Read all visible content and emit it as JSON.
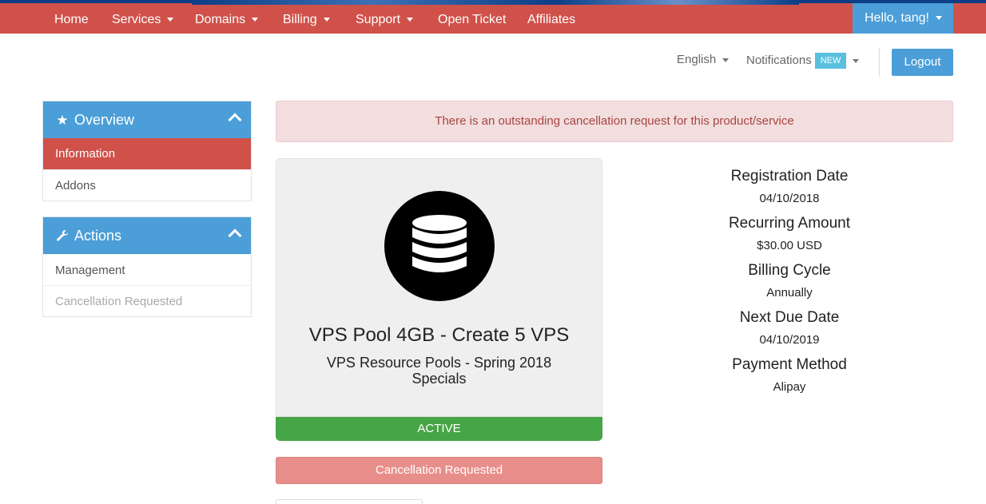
{
  "nav": {
    "items": [
      {
        "label": "Home",
        "dropdown": false
      },
      {
        "label": "Services",
        "dropdown": true
      },
      {
        "label": "Domains",
        "dropdown": true
      },
      {
        "label": "Billing",
        "dropdown": true
      },
      {
        "label": "Support",
        "dropdown": true
      },
      {
        "label": "Open Ticket",
        "dropdown": false
      },
      {
        "label": "Affiliates",
        "dropdown": false
      }
    ],
    "account_label": "Hello, tang!"
  },
  "secondary": {
    "language": "English",
    "notifications": "Notifications",
    "new_badge": "NEW",
    "logout": "Logout"
  },
  "sidebar": {
    "overview": {
      "title": "Overview",
      "icon": "star-icon",
      "items": [
        {
          "label": "Information",
          "state": "active"
        },
        {
          "label": "Addons",
          "state": "normal"
        }
      ]
    },
    "actions": {
      "title": "Actions",
      "icon": "wrench-icon",
      "items": [
        {
          "label": "Management",
          "state": "normal"
        },
        {
          "label": "Cancellation Requested",
          "state": "disabled"
        }
      ]
    }
  },
  "alert": {
    "message": "There is an outstanding cancellation request for this product/service"
  },
  "product": {
    "icon": "database-icon",
    "name": "VPS Pool 4GB - Create 5 VPS",
    "group": "VPS Resource Pools - Spring 2018 Specials",
    "status": "ACTIVE",
    "cancel_label": "Cancellation Requested"
  },
  "details": [
    {
      "label": "Registration Date",
      "value": "04/10/2018"
    },
    {
      "label": "Recurring Amount",
      "value": "$30.00 USD"
    },
    {
      "label": "Billing Cycle",
      "value": "Annually"
    },
    {
      "label": "Next Due Date",
      "value": "04/10/2019"
    },
    {
      "label": "Payment Method",
      "value": "Alipay"
    }
  ],
  "colors": {
    "nav": "#d0514a",
    "primary": "#4b9ed8",
    "active_status": "#46a546",
    "cancel": "#e88e8a",
    "alert_bg": "#f2dede",
    "alert_text": "#a94442"
  }
}
